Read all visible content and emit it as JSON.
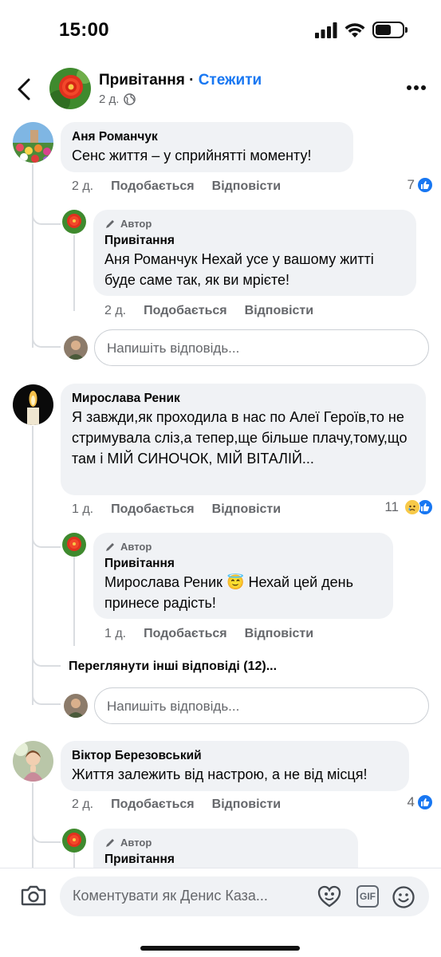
{
  "status_bar": {
    "time": "15:00",
    "battery_level": 0.6
  },
  "header": {
    "title": "Привітання",
    "separator": " · ",
    "follow_label": "Стежити",
    "time_ago": "2 д."
  },
  "comments": [
    {
      "author": "Аня Романчук",
      "text": "Сенс життя – у сприйнятті моменту!",
      "time": "2 д.",
      "like_label": "Подобається",
      "reply_label": "Відповісти",
      "reaction_count": "7",
      "reply": {
        "badge": "Автор",
        "author": "Привітання",
        "text": "Аня Романчук Нехай усе у вашому житті буде саме так, як ви мрієте!",
        "time": "2 д.",
        "like_label": "Подобається",
        "reply_label": "Відповісти"
      },
      "reply_placeholder": "Напишіть відповідь..."
    },
    {
      "author": "Мирослава Реник",
      "text": "Я завжди,як проходила в нас по Алеї Героїв,то не стримувала сліз,а тепер,ще більше плачу,тому,що там і МІЙ СИНОЧОК, МІЙ ВІТАЛІЙ...",
      "time": "1 д.",
      "like_label": "Подобається",
      "reply_label": "Відповісти",
      "reaction_count": "11",
      "reply": {
        "badge": "Автор",
        "author": "Привітання",
        "text_before": "Мирослава Реник",
        "emoji": "😇",
        "text_after": "Нехай цей день принесе радість!",
        "time": "1 д.",
        "like_label": "Подобається",
        "reply_label": "Відповісти"
      },
      "view_more": "Переглянути інші відповіді (12)...",
      "reply_placeholder": "Напишіть відповідь..."
    },
    {
      "author": "Віктор Березовський",
      "text": "Життя залежить від настрою, а не від місця!",
      "time": "2 д.",
      "like_label": "Подобається",
      "reply_label": "Відповісти",
      "reaction_count": "4",
      "reply": {
        "badge": "Автор",
        "author": "Привітання"
      }
    }
  ],
  "composer": {
    "placeholder": "Коментувати як Денис Каза",
    "gif_label": "GIF"
  },
  "colors": {
    "accent": "#1877f2",
    "bubble": "#f0f2f5",
    "muted": "#65676b"
  }
}
